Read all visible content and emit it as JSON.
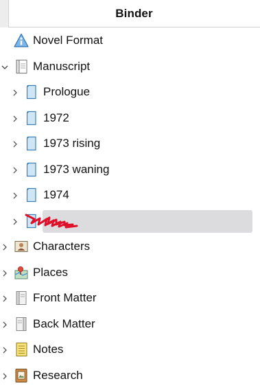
{
  "binder": {
    "title": "Binder",
    "items": [
      {
        "label": "Novel Format",
        "icon": "info-icon"
      },
      {
        "label": "Manuscript",
        "icon": "manuscript-folder-icon",
        "expanded": true
      },
      {
        "label": "Prologue",
        "icon": "document-icon"
      },
      {
        "label": "1972",
        "icon": "document-icon"
      },
      {
        "label": "1973 rising",
        "icon": "document-icon"
      },
      {
        "label": "1973 waning",
        "icon": "document-icon"
      },
      {
        "label": "1974",
        "icon": "document-icon"
      },
      {
        "label": "",
        "icon": "document-icon",
        "selected": true,
        "redacted": true
      },
      {
        "label": "Characters",
        "icon": "characters-icon"
      },
      {
        "label": "Places",
        "icon": "places-icon"
      },
      {
        "label": "Front Matter",
        "icon": "front-matter-icon"
      },
      {
        "label": "Back Matter",
        "icon": "back-matter-icon"
      },
      {
        "label": "Notes",
        "icon": "notes-icon"
      },
      {
        "label": "Research",
        "icon": "research-icon"
      }
    ]
  },
  "colors": {
    "selection": "#dcdcdf",
    "document_fill": "#cfe6f7",
    "document_stroke": "#3c7fb8",
    "redaction": "#e0102a"
  }
}
